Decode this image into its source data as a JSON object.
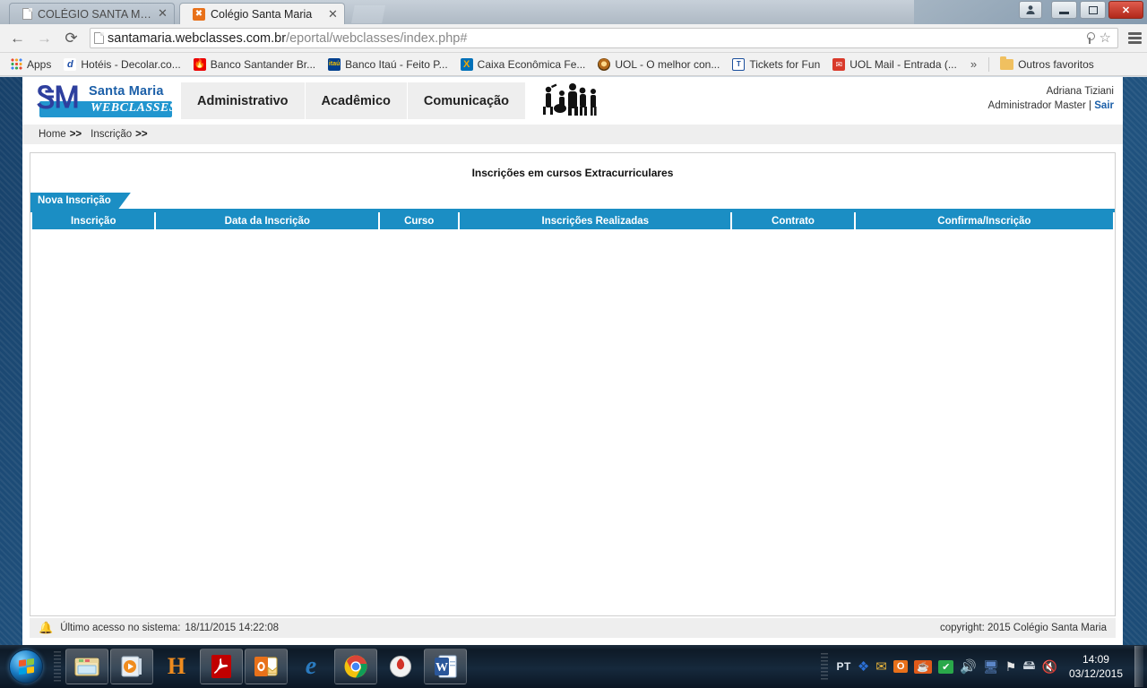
{
  "browser": {
    "tabs": [
      {
        "title": "COLÉGIO SANTA MARIA -",
        "favicon": "document-icon",
        "active": false
      },
      {
        "title": "Colégio Santa Maria",
        "favicon": "orange-square-icon",
        "active": true
      }
    ],
    "close_label": "✕",
    "nav": {
      "back_label": "←",
      "forward_label": "→",
      "reload_label": "⟳"
    },
    "url": {
      "domain": "santamaria.webclasses.com.br",
      "path": "/eportal/webclasses/index.php#",
      "page_icon": "page-document-icon",
      "key_icon": "key-icon",
      "star_icon": "star-icon",
      "menu_icon": "hamburger-menu-icon"
    },
    "window_controls": {
      "person_label": "👤",
      "minimize_label": "—",
      "maximize_label": "❐",
      "close_label": "✕"
    },
    "bookmarks": {
      "apps_label": "Apps",
      "items": [
        {
          "label": "Hotéis - Decolar.co...",
          "icon": "decolar-icon",
          "color": "#1f4fa8"
        },
        {
          "label": "Banco Santander Br...",
          "icon": "santander-icon",
          "color": "#ec0000"
        },
        {
          "label": "Banco Itaú - Feito P...",
          "icon": "itau-icon",
          "color": "#003f8e"
        },
        {
          "label": "Caixa Econômica Fe...",
          "icon": "caixa-icon",
          "color": "#0070b8"
        },
        {
          "label": "UOL - O melhor con...",
          "icon": "uol-icon",
          "color": "#b46a1a"
        },
        {
          "label": "Tickets for Fun",
          "icon": "tickets-icon",
          "color": "#1b4f9c"
        },
        {
          "label": "UOL Mail - Entrada (...",
          "icon": "uolmail-icon",
          "color": "#d93a2b"
        }
      ],
      "overflow_label": "»",
      "other_label": "Outros favoritos",
      "other_icon": "folder-icon"
    }
  },
  "site": {
    "logo": {
      "mark": "ᏕᎷ",
      "line1": "Santa Maria",
      "line2": "WEBCLASSES"
    },
    "nav_items": [
      {
        "label": "Administrativo"
      },
      {
        "label": "Acadêmico"
      },
      {
        "label": "Comunicação"
      }
    ],
    "people_icon": "people-group-icon",
    "user": {
      "name": "Adriana Tiziani",
      "role": "Administrador Master",
      "separator": "|",
      "logout_label": "Sair"
    },
    "breadcrumb": {
      "home": "Home",
      "sep1": ">>",
      "section": "Inscrição",
      "sep2": ">>"
    },
    "content": {
      "title": "Inscrições em cursos Extracurriculares",
      "tab_label": "Nova Inscrição",
      "table": {
        "columns": [
          "Inscrição",
          "Data da Inscrição",
          "Curso",
          "Inscrições Realizadas",
          "Contrato",
          "Confirma/Inscrição"
        ],
        "rows": []
      }
    },
    "footer": {
      "bell_icon": "bell-icon",
      "last_access_label": "Último acesso no sistema:",
      "last_access_value": "18/11/2015 14:22:08",
      "copyright": "copyright: 2015 Colégio Santa Maria"
    },
    "accent_color": "#1b8ec4"
  },
  "taskbar": {
    "start_label": "start-orb-icon",
    "items": [
      {
        "name": "windows-explorer-icon",
        "glyph": "🗂"
      },
      {
        "name": "media-player-icon",
        "glyph": "▶"
      },
      {
        "name": "h-app-icon",
        "glyph": "H"
      },
      {
        "name": "adobe-reader-icon",
        "glyph": "A"
      },
      {
        "name": "outlook-icon",
        "glyph": "O"
      },
      {
        "name": "internet-explorer-icon",
        "glyph": "e"
      },
      {
        "name": "google-chrome-icon",
        "glyph": "◉"
      },
      {
        "name": "firefox-like-icon",
        "glyph": "●"
      },
      {
        "name": "microsoft-word-icon",
        "glyph": "W"
      }
    ],
    "tray": {
      "language": "PT",
      "icons": [
        {
          "name": "dropbox-icon",
          "glyph": "❖",
          "color": "#2b6fd6"
        },
        {
          "name": "mail-icon",
          "glyph": "✉",
          "color": "#e8b33a"
        },
        {
          "name": "office-icon",
          "glyph": "O",
          "color": "#e8701a"
        },
        {
          "name": "java-icon",
          "glyph": "☕",
          "color": "#e05a1a"
        },
        {
          "name": "antivirus-check-icon",
          "glyph": "✔",
          "color": "#2aa84a"
        },
        {
          "name": "volume-red-icon",
          "glyph": "🔊",
          "color": "#d93a2b"
        },
        {
          "name": "network-monitor-icon",
          "glyph": "🖥",
          "color": "#5b86c7"
        },
        {
          "name": "flag-action-center-icon",
          "glyph": "⚑",
          "color": "#e6e6e6"
        },
        {
          "name": "remove-device-icon",
          "glyph": "⏏",
          "color": "#cfd7df"
        },
        {
          "name": "volume-muted-icon",
          "glyph": "🔇",
          "color": "#d0d8e0"
        }
      ],
      "time": "14:09",
      "date": "03/12/2015"
    }
  }
}
